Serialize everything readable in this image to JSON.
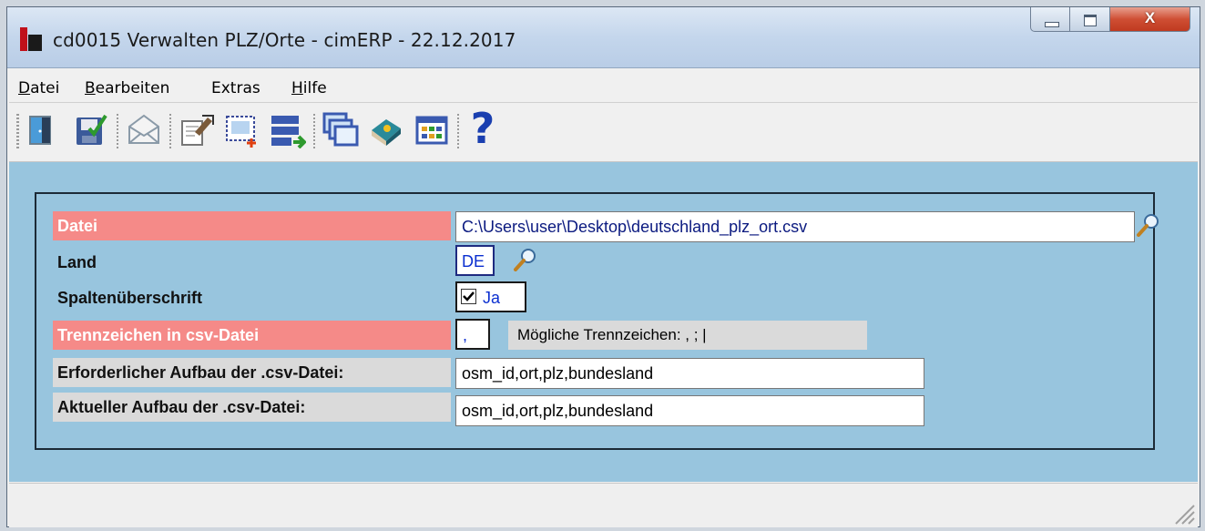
{
  "window": {
    "title": "cd0015 Verwalten PLZ/Orte - cimERP - 22.12.2017",
    "close_glyph": "X"
  },
  "menu": [
    {
      "label": "Datei",
      "first": "D",
      "rest": "atei"
    },
    {
      "label": "Bearbeiten",
      "first": "B",
      "rest": "earbeiten"
    },
    {
      "label": "Extras",
      "first": "",
      "rest": "Extras"
    },
    {
      "label": "Hilfe",
      "first": "H",
      "rest": "ilfe"
    }
  ],
  "toolbar": {
    "icons": [
      "exit-door-icon",
      "save-icon",
      "mail-envelope-icon",
      "edit-document-icon",
      "new-record-icon",
      "import-list-icon",
      "windows-cascade-icon",
      "book-icon",
      "table-grid-icon",
      "help-icon"
    ],
    "help_glyph": "?"
  },
  "form": {
    "datei": {
      "label": "Datei",
      "value": "C:\\Users\\user\\Desktop\\deutschland_plz_ort.csv"
    },
    "land": {
      "label": "Land",
      "value": "DE"
    },
    "spaltenueberschrift": {
      "label": "Spaltenüberschrift",
      "value": "Ja",
      "checked": true
    },
    "trennzeichen": {
      "label": "Trennzeichen in csv-Datei",
      "value": ",",
      "hint": "Mögliche Trennzeichen: , ; |"
    },
    "erforderlich": {
      "label": "Erforderlicher Aufbau der .csv-Datei:",
      "value": "osm_id,ort,plz,bundesland"
    },
    "aktuell": {
      "label": "Aktueller Aufbau der .csv-Datei:",
      "value": "osm_id,ort,plz,bundesland"
    }
  },
  "colors": {
    "required_label": "#f58a88",
    "content_bg": "#98c5de",
    "field_text_blue": "#0b2fd0"
  }
}
